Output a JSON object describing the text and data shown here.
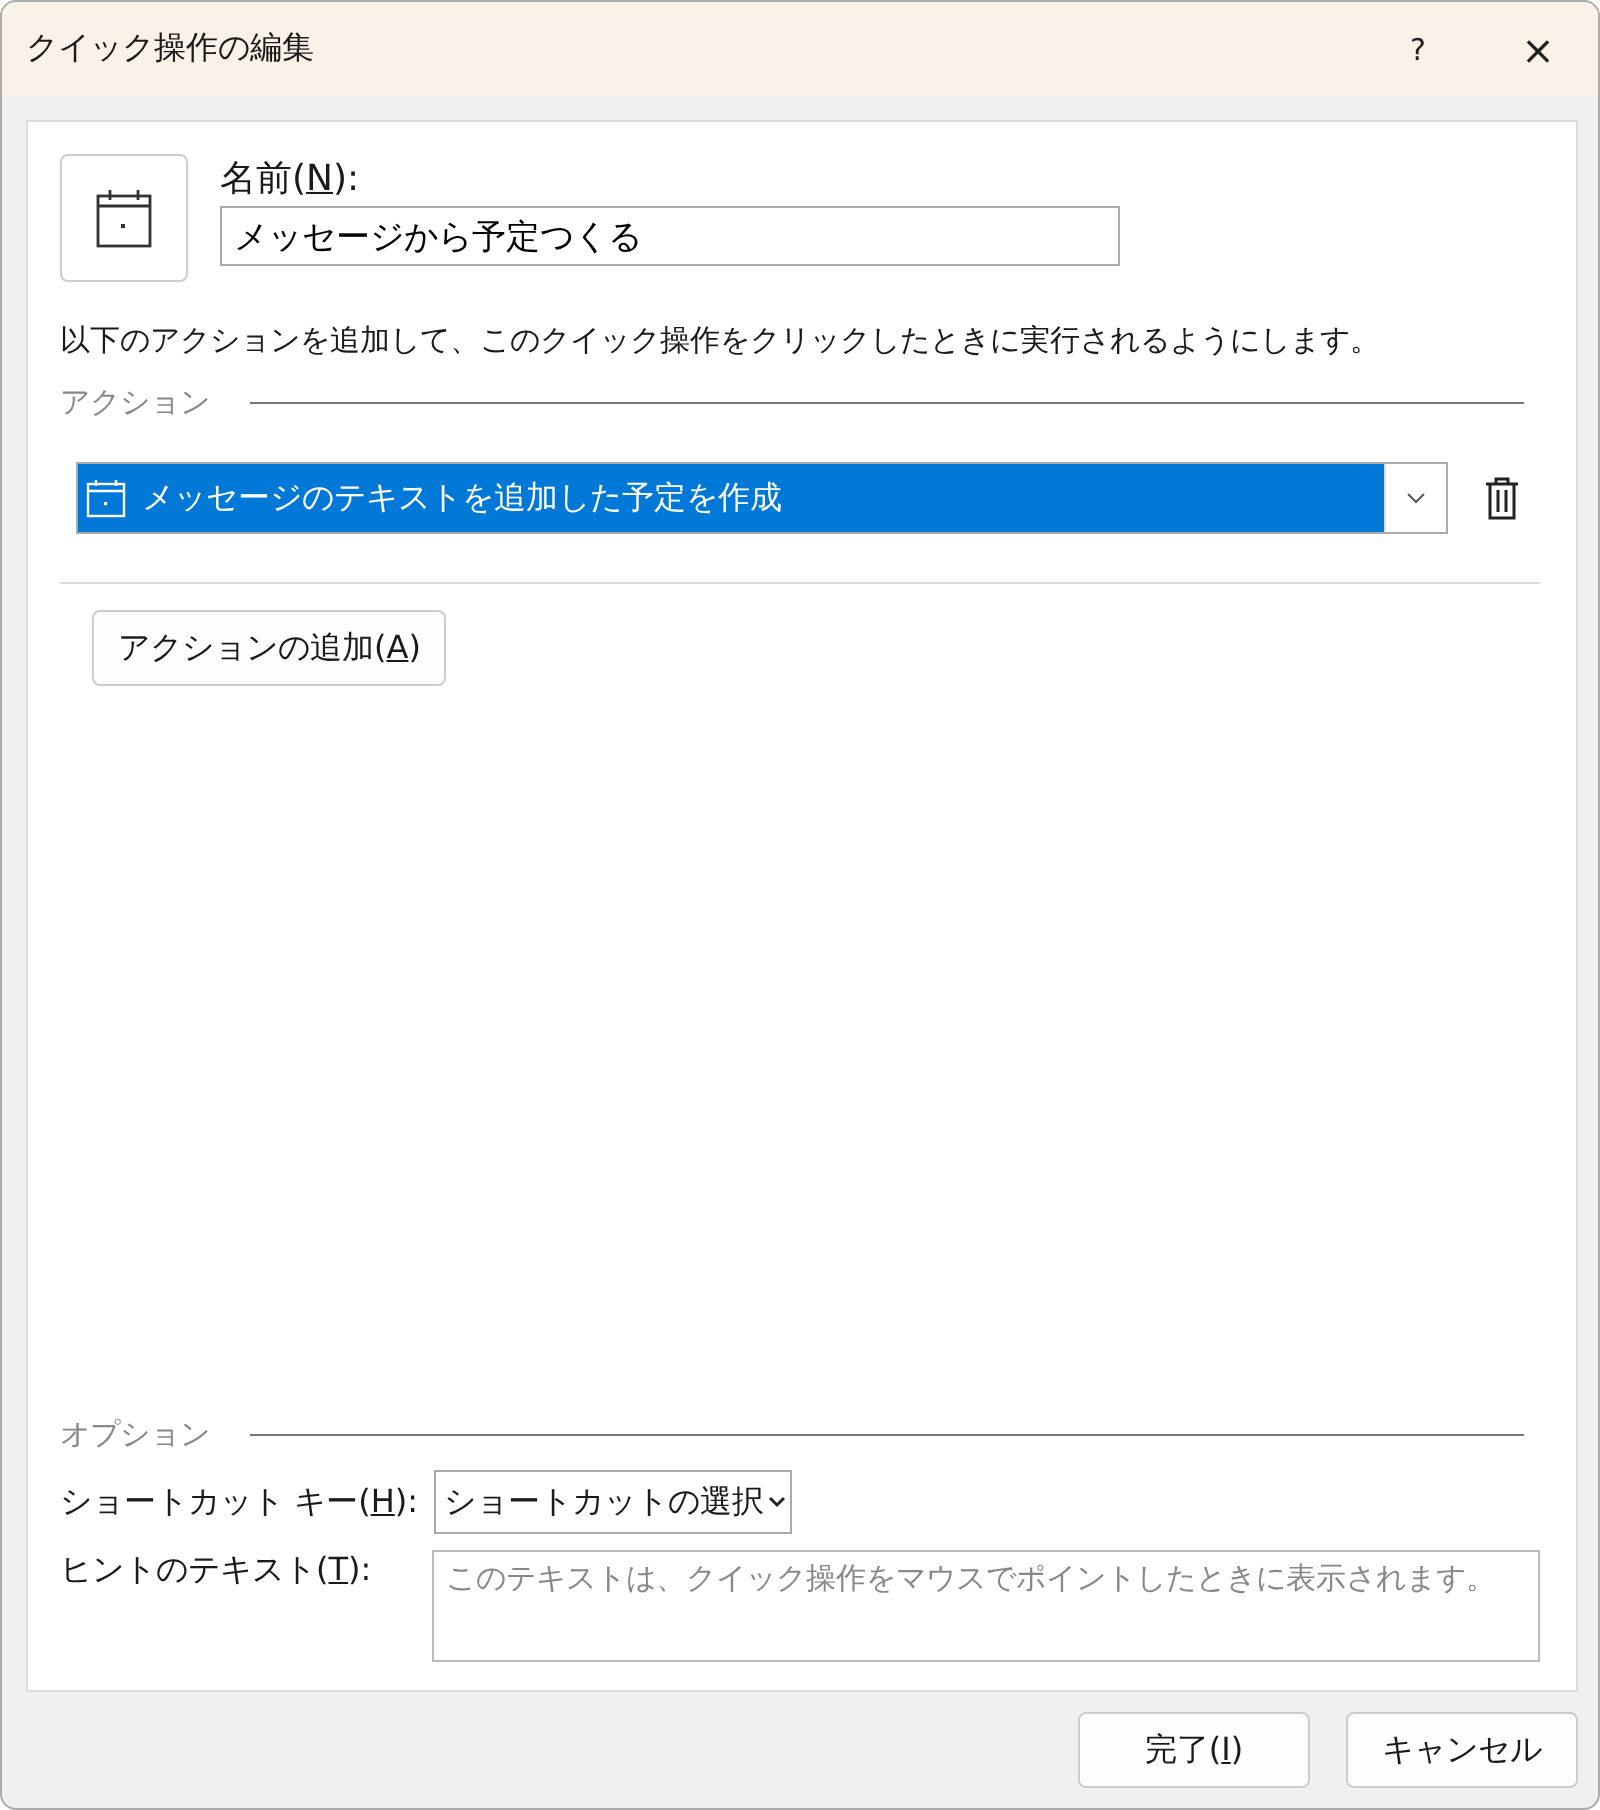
{
  "window": {
    "title": "クイック操作の編集",
    "help": "?",
    "close": "×"
  },
  "name_field": {
    "label": {
      "before": "名前(",
      "mnemonic": "N",
      "after": "):"
    },
    "value": "メッセージから予定つくる"
  },
  "description": "以下のアクションを追加して、このクイック操作をクリックしたときに実行されるようにします。",
  "actions_section": {
    "heading": "アクション",
    "actions": [
      {
        "text": "メッセージのテキストを追加した予定を作成",
        "selected": true
      }
    ],
    "add_button": {
      "before": "アクションの追加(",
      "mnemonic": "A",
      "after": ")"
    }
  },
  "options_section": {
    "heading": "オプション",
    "shortcut": {
      "label": {
        "before": "ショートカット キー(",
        "mnemonic": "H",
        "after": "):"
      },
      "value": "ショートカットの選択"
    },
    "hint": {
      "label": {
        "before": "ヒントのテキスト(",
        "mnemonic": "T",
        "after": "):"
      },
      "placeholder": "このテキストは、クイック操作をマウスでポイントしたときに表示されます。"
    }
  },
  "buttons": [
    {
      "before": "完了(",
      "mnemonic": "I",
      "after": ")"
    },
    {
      "before": "キャンセル"
    }
  ]
}
